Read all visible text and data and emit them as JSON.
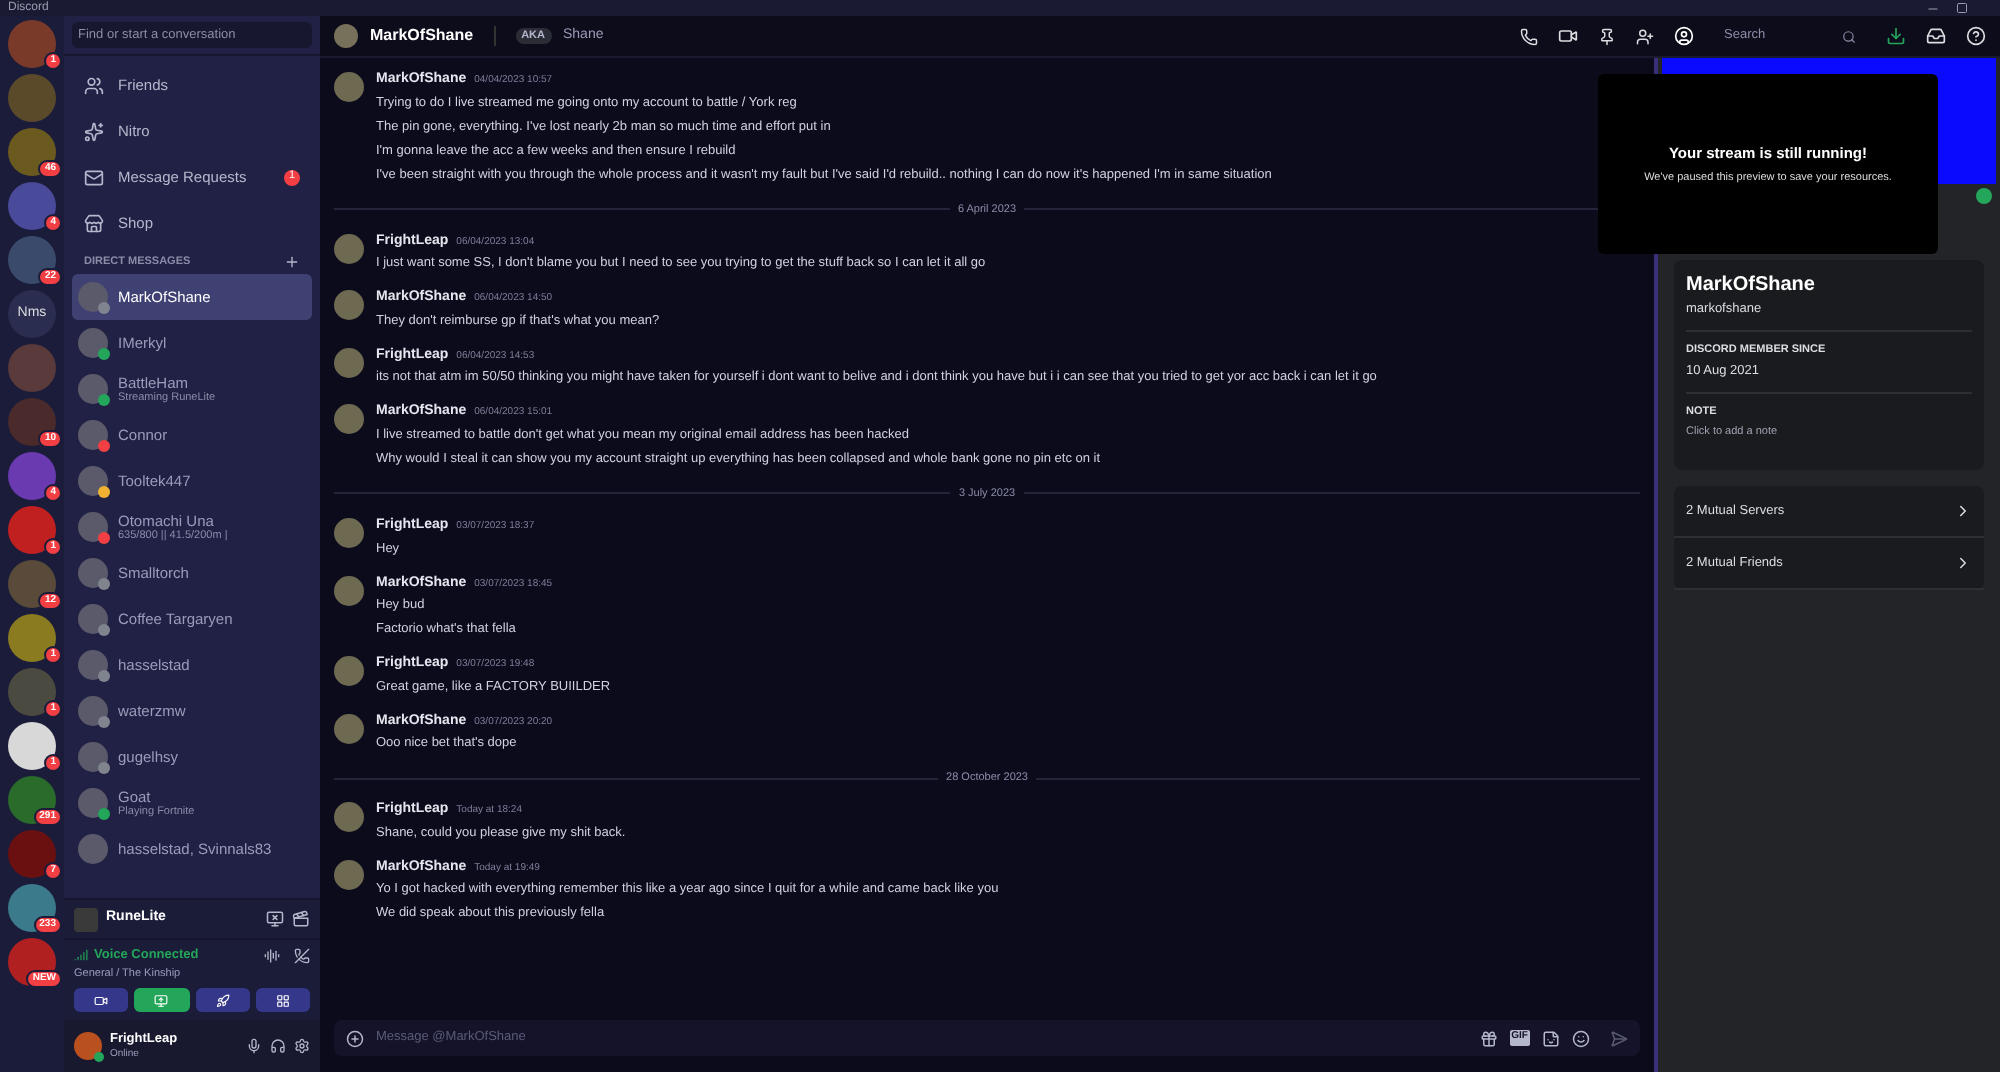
{
  "window": {
    "title": "Discord"
  },
  "servers": [
    {
      "kind": "image",
      "badge": "1"
    },
    {
      "kind": "image"
    },
    {
      "kind": "image",
      "badge": "46"
    },
    {
      "kind": "image",
      "badge": "4"
    },
    {
      "kind": "image",
      "badge": "22"
    },
    {
      "kind": "text",
      "label": "Nms"
    },
    {
      "kind": "image"
    },
    {
      "kind": "image",
      "badge": "10"
    },
    {
      "kind": "image",
      "badge": "4"
    },
    {
      "kind": "image",
      "badge": "1"
    },
    {
      "kind": "image",
      "badge": "12"
    },
    {
      "kind": "image",
      "badge": "1"
    },
    {
      "kind": "image",
      "badge": "1"
    },
    {
      "kind": "image",
      "badge": "1"
    },
    {
      "kind": "image",
      "badge": "291"
    },
    {
      "kind": "image",
      "badge": "7"
    },
    {
      "kind": "image",
      "badge": "233"
    },
    {
      "kind": "image",
      "badge": "NEW"
    }
  ],
  "search": {
    "placeholder": "Find or start a conversation"
  },
  "nav": [
    {
      "kind": "friends",
      "label": "Friends"
    },
    {
      "kind": "nitro",
      "label": "Nitro"
    },
    {
      "kind": "requests",
      "label": "Message Requests",
      "badge": "1"
    },
    {
      "kind": "shop",
      "label": "Shop"
    }
  ],
  "dm_header": "DIRECT MESSAGES",
  "dms": [
    {
      "name": "MarkOfShane",
      "color": "#80848e",
      "selected": true
    },
    {
      "name": "IMerkyl",
      "color": "#23a55a",
      "selected": false
    },
    {
      "name": "BattleHam",
      "subtitle": "Streaming RuneLite",
      "color": "#23a55a",
      "selected": false
    },
    {
      "name": "Connor",
      "color": "#f23f43",
      "selected": false
    },
    {
      "name": "Tooltek447",
      "color": "#f0b232",
      "selected": false
    },
    {
      "name": "Otomachi Una",
      "subtitle": "635/800 || 41.5/200m |",
      "color": "#f23f43",
      "selected": false
    },
    {
      "name": "Smalltorch",
      "color": "#80848e",
      "selected": false
    },
    {
      "name": "Coffee Targaryen",
      "color": "#80848e",
      "selected": false
    },
    {
      "name": "hasselstad",
      "color": "#80848e",
      "selected": false
    },
    {
      "name": "waterzmw",
      "color": "#80848e",
      "selected": false
    },
    {
      "name": "gugelhsy",
      "color": "#80848e",
      "selected": false
    },
    {
      "name": "Goat",
      "subtitle": "Playing Fortnite",
      "color": "#23a55a",
      "selected": false
    },
    {
      "name": "hasselstad, Svinnals83",
      "selected": false
    }
  ],
  "stream": {
    "app": "RuneLite"
  },
  "voice": {
    "status": "Voice Connected",
    "channel": "General / The Kinship",
    "buttons": [
      {
        "kind": "camera",
        "selected": false
      },
      {
        "kind": "screen",
        "selected": true
      },
      {
        "kind": "activity",
        "selected": false
      },
      {
        "kind": "soundboard",
        "selected": false
      }
    ]
  },
  "user": {
    "name": "FrightLeap",
    "status": "Online"
  },
  "header": {
    "name": "MarkOfShane",
    "aka": "AKA",
    "nickname": "Shane",
    "search_placeholder": "Search"
  },
  "chat": [
    {
      "kind": "message",
      "author": "MarkOfShane",
      "time": "04/04/2023 10:57",
      "lines": [
        "Trying to do I live streamed me going onto my account to battle / York reg",
        "The pin gone, everything. I've lost nearly 2b man so much time and effort put in",
        "I'm gonna leave the acc a few weeks and then ensure I rebuild",
        "I've been straight with you through the whole process and it wasn't my fault but I've said I'd rebuild.. nothing I can do now it's happened I'm in same situation"
      ]
    },
    {
      "kind": "divider",
      "label": "6 April 2023"
    },
    {
      "kind": "message",
      "author": "FrightLeap",
      "time": "06/04/2023 13:04",
      "lines": [
        "I just want some SS, I don't blame you but I need to see you trying to get the stuff back so I can let it all go"
      ]
    },
    {
      "kind": "message",
      "author": "MarkOfShane",
      "time": "06/04/2023 14:50",
      "lines": [
        "They don't reimburse gp if that's what you mean?"
      ]
    },
    {
      "kind": "message",
      "author": "FrightLeap",
      "time": "06/04/2023 14:53",
      "lines": [
        "its not that atm im 50/50 thinking you might have taken for yourself i dont want to belive and i dont think you have but i i can see that you tried to get yor acc back i can let it go"
      ]
    },
    {
      "kind": "message",
      "author": "MarkOfShane",
      "time": "06/04/2023 15:01",
      "lines": [
        "I live streamed to battle don't get what you mean my original email address has been hacked",
        "Why would I steal it can show you my account straight up everything has been collapsed and whole bank gone no pin etc on it"
      ]
    },
    {
      "kind": "divider",
      "label": "3 July 2023"
    },
    {
      "kind": "message",
      "author": "FrightLeap",
      "time": "03/07/2023 18:37",
      "lines": [
        "Hey"
      ]
    },
    {
      "kind": "message",
      "author": "MarkOfShane",
      "time": "03/07/2023 18:45",
      "lines": [
        "Hey bud",
        "Factorio what's that fella"
      ]
    },
    {
      "kind": "message",
      "author": "FrightLeap",
      "time": "03/07/2023 19:48",
      "lines": [
        "Great game, like a FACTORY BUIILDER"
      ]
    },
    {
      "kind": "message",
      "author": "MarkOfShane",
      "time": "03/07/2023 20:20",
      "lines": [
        "Ooo nice bet that's dope"
      ]
    },
    {
      "kind": "divider",
      "label": "28 October 2023"
    },
    {
      "kind": "message",
      "author": "FrightLeap",
      "time": "Today at 18:24",
      "lines": [
        "Shane, could you please give my shit back."
      ]
    },
    {
      "kind": "message",
      "author": "MarkOfShane",
      "time": "Today at 19:49",
      "lines": [
        "Yo I got hacked with everything remember this like a year ago since I quit for a while and came back like you",
        "We did speak about this previously fella"
      ]
    }
  ],
  "composer": {
    "placeholder": "Message @MarkOfShane",
    "gif": "GIF"
  },
  "stream_notice": {
    "title": "Your stream is still running!",
    "body": "We've paused this preview to save your resources."
  },
  "profile": {
    "display_name": "MarkOfShane",
    "username": "markofshane",
    "member_label": "DISCORD MEMBER SINCE",
    "member_since": "10 Aug 2021",
    "note_label": "NOTE",
    "note_placeholder": "Click to add a note",
    "links": [
      "2 Mutual Servers",
      "2 Mutual Friends"
    ]
  }
}
